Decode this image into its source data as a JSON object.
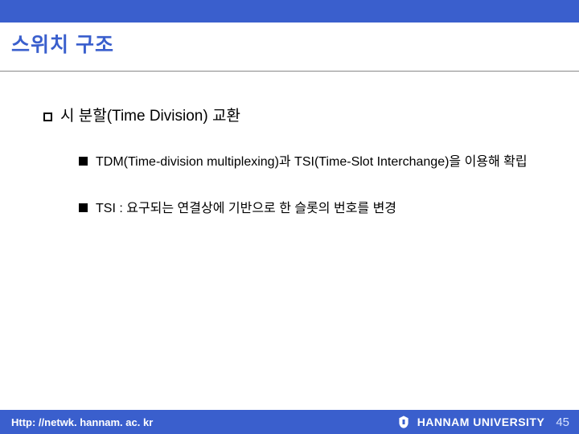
{
  "title": "스위치 구조",
  "heading": "시 분할(Time Division) 교환",
  "bullets": [
    "TDM(Time-division multiplexing)과 TSI(Time-Slot Interchange)을 이용해 확립",
    "TSI : 요구되는 연결상에 기반으로 한 슬롯의 번호를 변경"
  ],
  "footer": {
    "url": "Http: //netwk. hannam. ac. kr",
    "university": "HANNAM  UNIVERSITY",
    "page": "45"
  }
}
